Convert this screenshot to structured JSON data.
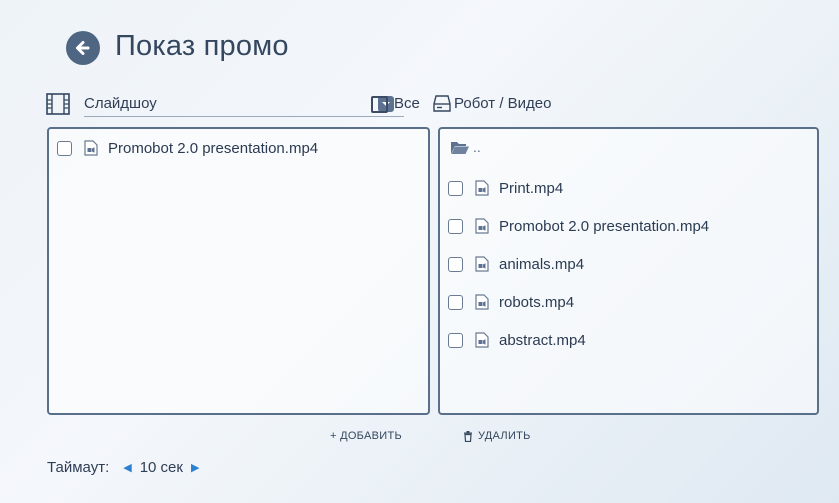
{
  "header": {
    "title": "Показ промо"
  },
  "toolbar": {
    "mode": "Слайдшоу",
    "all_label": "Все",
    "path": "Робот / Видео"
  },
  "left_panel": {
    "files": [
      "Promobot 2.0 presentation.mp4"
    ]
  },
  "right_panel": {
    "parent_dir": "..",
    "files": [
      "Print.mp4",
      "Promobot 2.0 presentation.mp4",
      "animals.mp4",
      "robots.mp4",
      "abstract.mp4"
    ]
  },
  "actions": {
    "add": "+ ДОБАВИТЬ",
    "delete": "УДАЛИТЬ"
  },
  "timeout": {
    "label": "Таймаут:",
    "value": "10 сек"
  },
  "colors": {
    "accent": "#4f6683",
    "arrow": "#2d7fd0",
    "border": "#5a6f89"
  }
}
